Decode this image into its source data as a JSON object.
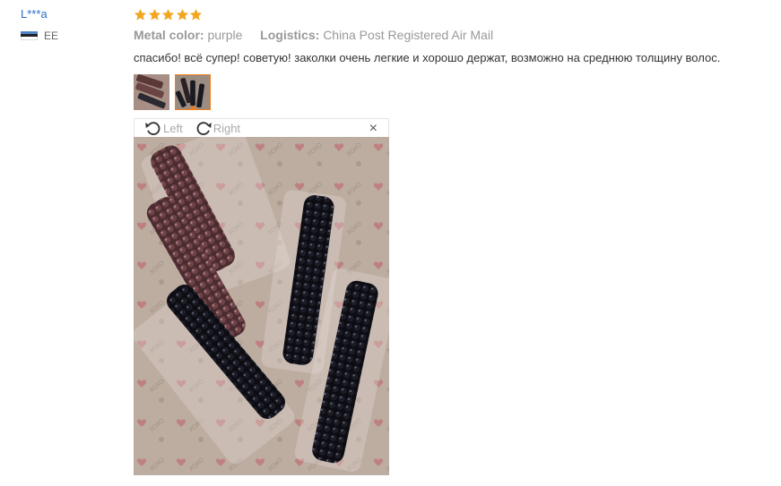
{
  "reviewer": {
    "name": "L***a",
    "country_code": "EE",
    "flag_colors": [
      "#4f83c8",
      "#222222",
      "#ffffff"
    ]
  },
  "review": {
    "stars": 5,
    "star_color": "#f2a61f",
    "metal_color_label": "Metal color:",
    "metal_color_value": "purple",
    "logistics_label": "Logistics:",
    "logistics_value": "China Post Registered Air Mail",
    "text": "спасибо! всё супер! советую! заколки очень легкие и хорошо держат, возможно на среднюю толщину волос.",
    "photos": [
      {
        "icon": "photo-thumbnail-purple-clips"
      },
      {
        "icon": "photo-thumbnail-black-clips",
        "selected": true
      }
    ]
  },
  "viewer": {
    "rotate_left_label": "Left",
    "rotate_right_label": "Right",
    "close_symbol": "×"
  },
  "colors": {
    "accent": "#f07e1b",
    "link": "#2b6ccb"
  }
}
